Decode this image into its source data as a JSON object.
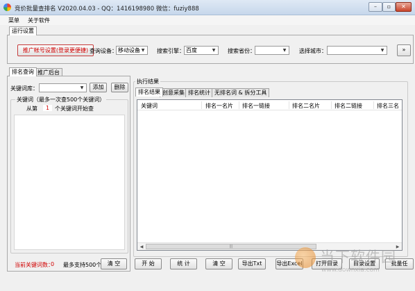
{
  "window": {
    "title": "竞价批量查排名 V2020.04.03 - QQ：1416198980  微信：fuziy888",
    "minimize": "–",
    "restore": "▫",
    "close": "✕"
  },
  "menu": [
    "菜单",
    "关于软件"
  ],
  "run_settings": {
    "tab_label": "运行设置",
    "account_button": "推广帐号设置(登录更便捷)",
    "device_label": "查询设备：",
    "device_value": "移动设备",
    "engine_label": "搜索引擎：",
    "engine_value": "百度",
    "province_label": "搜索省份：",
    "province_value": "",
    "city_label": "选择城市：",
    "city_value": "",
    "more_button": "»"
  },
  "left_tabs": [
    "排名查询",
    "推广后台"
  ],
  "keyword": {
    "library_label": "关键词库：",
    "library_value": "",
    "add_button": "添加",
    "delete_button": "删除",
    "group_title": "关键词（最多一次查500个关键词）",
    "start_prefix": "从第",
    "start_value": "1",
    "start_suffix": "个关键词开始查",
    "current_count_label": "当前关键词数：",
    "current_count": "0",
    "max_support": "最多支持500个",
    "clear_button": "清 空"
  },
  "result": {
    "group_title": "执行结果",
    "tabs": [
      "排名结果",
      "创意采集",
      "排名统计",
      "无排名词 & 拆分工具"
    ],
    "columns": [
      "关键词",
      "排名一名片",
      "排名一链接",
      "排名二名片",
      "排名二链接",
      "排名三名"
    ]
  },
  "bottom_buttons": [
    "开 始",
    "统 计",
    "清 空",
    "导出Txt",
    "导出Excel",
    "打开目录",
    "目录设置",
    "批量任"
  ],
  "watermark": {
    "text": "当下软件园",
    "sub": "www.downxia.com"
  }
}
